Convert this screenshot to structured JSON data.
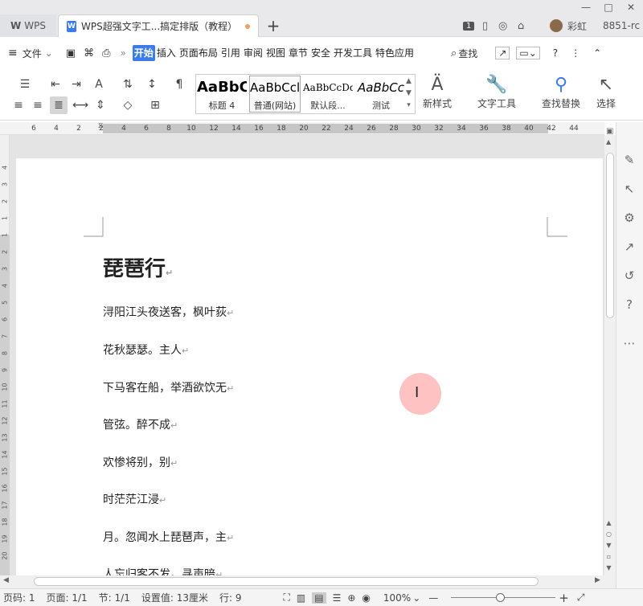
{
  "window": {
    "app_tab": "WPS",
    "doc_tab": "WPS超强文字工...搞定排版（教程）",
    "new_tab": "+"
  },
  "topright": {
    "badge": "1",
    "user": "彩虹",
    "id": "8851-rc",
    "minimize": "—",
    "maximize": "□",
    "close": "✕"
  },
  "menu": {
    "hamburger": "≡",
    "file": "文件",
    "items": [
      "开始",
      "插入",
      "页面布局",
      "引用",
      "审阅",
      "视图",
      "章节",
      "安全",
      "开发工具",
      "特色应用"
    ],
    "search": "查找"
  },
  "ribbon": {
    "styles": [
      {
        "sample": "AaBbC",
        "label": "标题 4"
      },
      {
        "sample": "AaBbCcl",
        "label": "普通(网站)"
      },
      {
        "sample": "AaBbCcDd",
        "label": "默认段..."
      },
      {
        "sample": "AaBbCc",
        "label": "测试"
      }
    ],
    "new_style": "新样式",
    "text_tools": "文字工具",
    "find_replace": "查找替换",
    "select": "选择"
  },
  "ruler": {
    "numbers": [
      "6",
      "4",
      "2",
      "2",
      "4",
      "6",
      "8",
      "10",
      "12",
      "14",
      "16",
      "18",
      "20",
      "22",
      "24",
      "26",
      "28",
      "30",
      "32",
      "34",
      "36",
      "38",
      "40",
      "42",
      "44"
    ]
  },
  "vruler": {
    "numbers": [
      "4",
      "3",
      "2",
      "1",
      "1",
      "2",
      "3",
      "4",
      "5",
      "6",
      "7",
      "8",
      "9",
      "10",
      "11",
      "12",
      "13",
      "14",
      "15",
      "16",
      "17",
      "18",
      "19",
      "20"
    ]
  },
  "document": {
    "title": "琵琶行",
    "paragraphs": [
      "浔阳江头夜送客，枫叶荻",
      "花秋瑟瑟。主人",
      "下马客在船，举酒欲饮无",
      "管弦。醉不成",
      "欢惨将别，别",
      "时茫茫江浸",
      "月。忽闻水上琵琶声，主",
      "人忘归客不发。寻声暗"
    ],
    "return_mark": "↵"
  },
  "status": {
    "page_code": "页码: 1",
    "page": "页面: 1/1",
    "section": "节: 1/1",
    "setting": "设置值: 13厘米",
    "row": "行: 9",
    "zoom": "100%",
    "zoom_level": 100
  }
}
